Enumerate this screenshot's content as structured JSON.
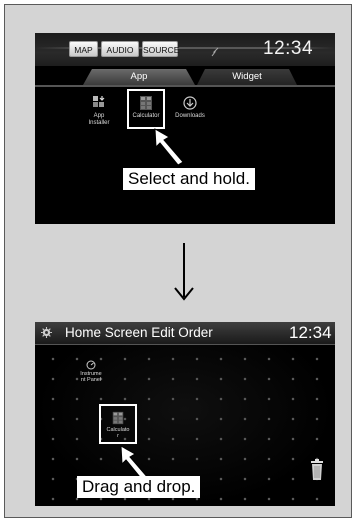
{
  "screen1": {
    "source_buttons": [
      "MAP",
      "AUDIO",
      "SOURCE"
    ],
    "clock": "12:34",
    "tabs": [
      "App",
      "Widget"
    ],
    "apps": [
      {
        "label": "App\nInstaller",
        "icon": "app-installer-icon"
      },
      {
        "label": "Calculator",
        "icon": "calculator-icon"
      },
      {
        "label": "Downloads",
        "icon": "downloads-icon"
      }
    ],
    "caption": "Select and hold."
  },
  "transition_icon": "down-arrow-icon",
  "screen2": {
    "title": "Home Screen Edit Order",
    "clock": "12:34",
    "instrument_panel_label": "Instrume\nnt Panel",
    "calculator_label": "Calculato\nr",
    "caption": "Drag and drop."
  },
  "colors": {
    "caption_bg": "#ffffff",
    "screen_bg": "#000000",
    "frame_bg": "#d4d4d4"
  }
}
